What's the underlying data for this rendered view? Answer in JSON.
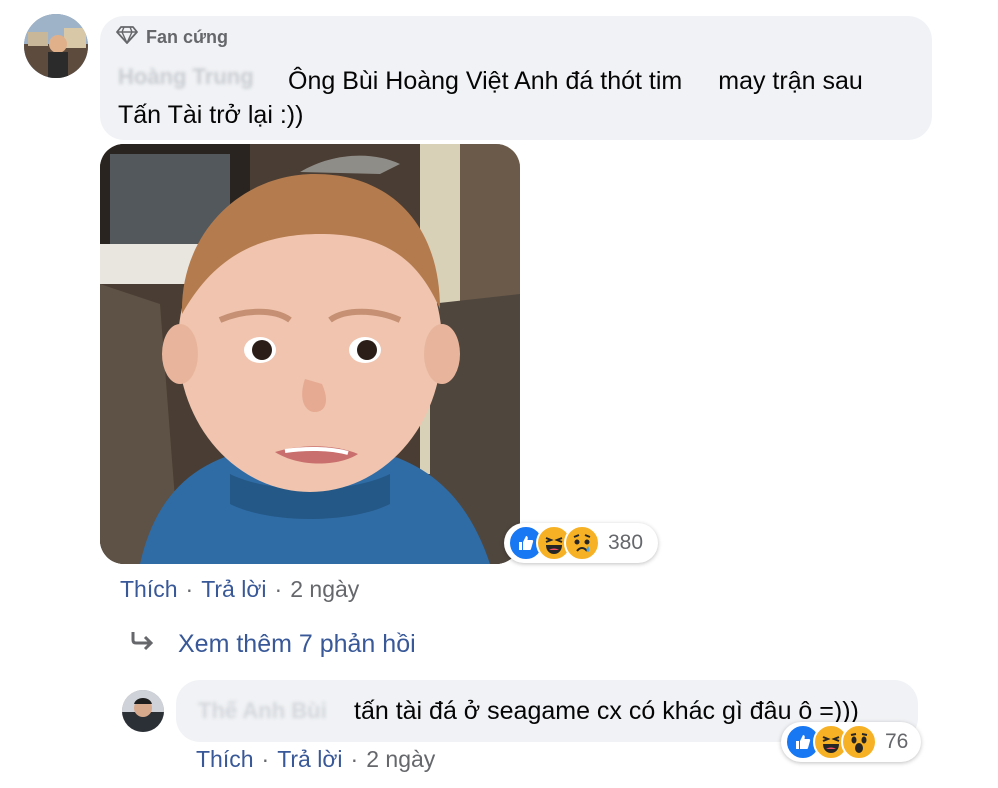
{
  "comment1": {
    "badge_label": "Fan cứng",
    "author_blurred": "Hoàng Trung",
    "text_line1_a": "Ông Bùi Hoàng Việt Anh đá thót tim",
    "text_line1_b": "may trận sau",
    "text_line2": "Tấn Tài trở lại :))",
    "reaction_count": "380",
    "reactions": [
      "like-icon",
      "haha-icon",
      "sad-icon"
    ],
    "actions": {
      "like": "Thích",
      "reply": "Trả lời",
      "time": "2 ngày"
    }
  },
  "see_more": {
    "label": "Xem thêm 7 phản hồi"
  },
  "comment2": {
    "author_blurred": "Thế Anh Bùi",
    "text": "tấn tài đá ở seagame cx có khác gì đâu ô =)))",
    "reaction_count": "76",
    "reactions": [
      "like-icon",
      "haha-icon",
      "wow-icon"
    ],
    "actions": {
      "like": "Thích",
      "reply": "Trả lời",
      "time": "2 ngày"
    }
  },
  "colors": {
    "bubble": "#f0f2f5",
    "link": "#385898",
    "muted": "#65676b",
    "like_blue": "#1877f2",
    "emoji_yellow": "#f7b125"
  }
}
